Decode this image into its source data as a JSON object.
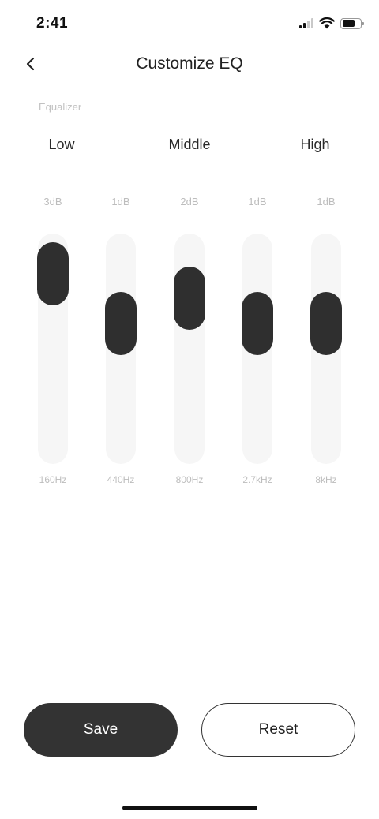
{
  "status_bar": {
    "time": "2:41",
    "icons": [
      "cellular-signal-icon",
      "wifi-icon",
      "battery-icon"
    ]
  },
  "nav": {
    "title": "Customize EQ",
    "back_icon": "chevron-left-icon"
  },
  "section_label": "Equalizer",
  "band_groups": [
    "Low",
    "Middle",
    "High"
  ],
  "sliders": [
    {
      "gain": "3dB",
      "freq": "160Hz",
      "level": 0.95
    },
    {
      "gain": "1dB",
      "freq": "440Hz",
      "level": 0.65
    },
    {
      "gain": "2dB",
      "freq": "800Hz",
      "level": 0.8
    },
    {
      "gain": "1dB",
      "freq": "2.7kHz",
      "level": 0.65
    },
    {
      "gain": "1dB",
      "freq": "8kHz",
      "level": 0.65
    }
  ],
  "actions": {
    "save_label": "Save",
    "reset_label": "Reset"
  },
  "colors": {
    "thumb": "#2f2f2f",
    "track": "#f6f6f6",
    "primary_button": "#333333",
    "muted_text": "#bdbdbd"
  }
}
